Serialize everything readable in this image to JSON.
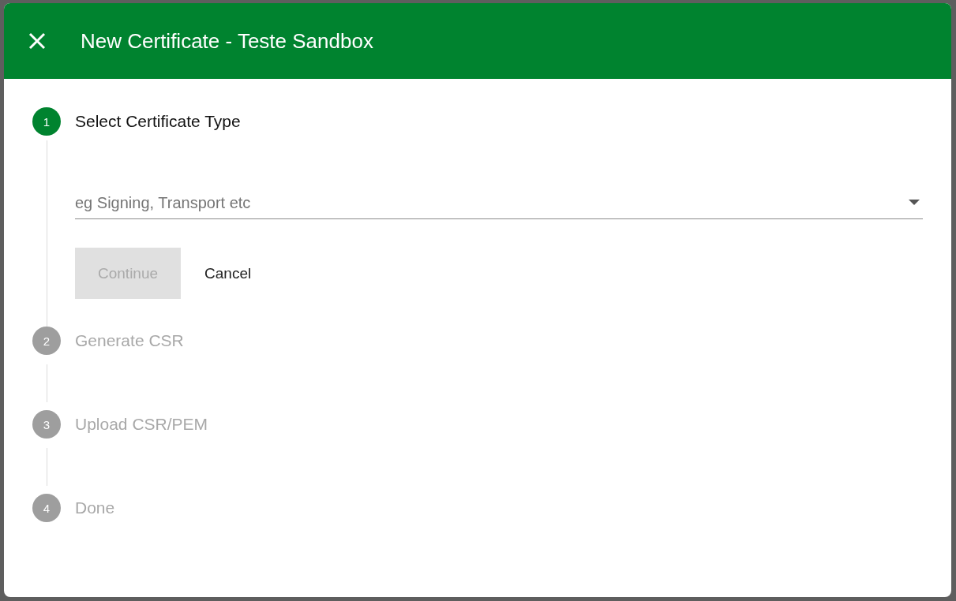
{
  "dialog": {
    "title": "New Certificate - Teste Sandbox"
  },
  "steps": [
    {
      "number": "1",
      "label": "Select Certificate Type",
      "active": true,
      "field": {
        "placeholder": "eg Signing, Transport etc"
      },
      "buttons": [
        {
          "kind": "primary",
          "label": "Continue",
          "disabled": true
        },
        {
          "kind": "text",
          "label": "Cancel",
          "disabled": false
        }
      ]
    },
    {
      "number": "2",
      "label": "Generate CSR",
      "active": false
    },
    {
      "number": "3",
      "label": "Upload CSR/PEM",
      "active": false
    },
    {
      "number": "4",
      "label": "Done",
      "active": false
    }
  ]
}
